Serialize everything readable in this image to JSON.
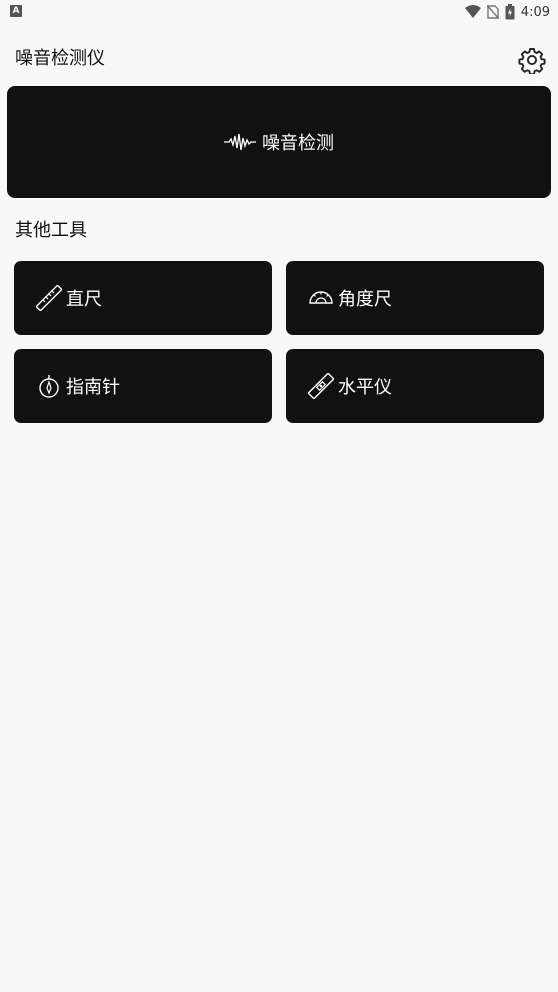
{
  "status_bar": {
    "left_badge": "A",
    "time": "4:09",
    "icons": [
      "wifi-icon",
      "no-sim-icon",
      "battery-charging-icon"
    ]
  },
  "app": {
    "title": "噪音检测仪",
    "settings_icon": "gear-icon"
  },
  "hero": {
    "label": "噪音检测",
    "icon": "sound-wave-icon"
  },
  "section": {
    "title": "其他工具"
  },
  "tools": [
    {
      "label": "直尺",
      "icon": "ruler-icon"
    },
    {
      "label": "角度尺",
      "icon": "protractor-icon"
    },
    {
      "label": "指南针",
      "icon": "compass-icon"
    },
    {
      "label": "水平仪",
      "icon": "spirit-level-icon"
    }
  ],
  "colors": {
    "background": "#f8f8f8",
    "card": "#111111",
    "text_on_card": "#ffffff"
  }
}
